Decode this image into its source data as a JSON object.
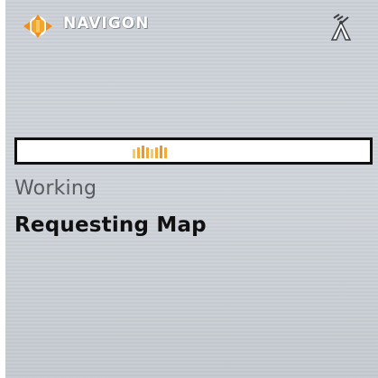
{
  "header": {
    "brand": "NAVIGON",
    "logo_icon": "navigon-logo-icon",
    "gps_icon": "gps-satellite-icon"
  },
  "progress": {
    "state": "indeterminate",
    "indicator_colors": [
      "#f6c65a",
      "#f3a52b",
      "#f08c1a",
      "#f3a52b",
      "#f6c65a"
    ]
  },
  "status": {
    "label": "Working",
    "message": "Requesting Map"
  },
  "colors": {
    "accent": "#f08c1a",
    "background": "#cbd0d6",
    "text_dark": "#000000",
    "text_muted": "#4a4d52"
  }
}
